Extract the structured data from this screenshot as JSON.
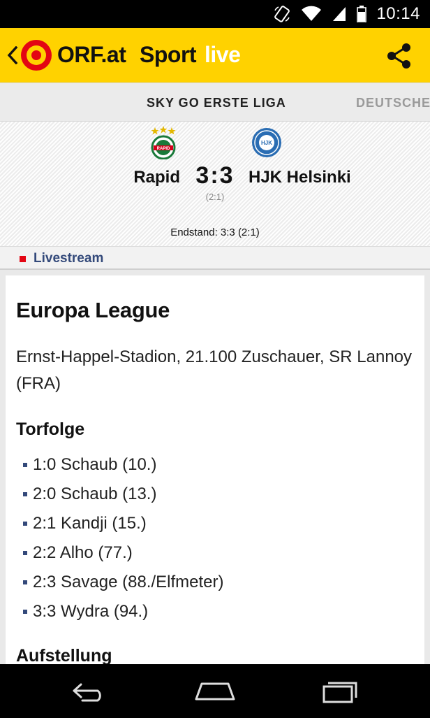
{
  "status_bar": {
    "time": "10:14",
    "icons": [
      "rotate-icon",
      "wifi-icon",
      "signal-icon",
      "battery-icon"
    ]
  },
  "header": {
    "brand": "ORF.at",
    "section": "Sport",
    "section_suffix": "live",
    "colors": {
      "background": "#ffd200",
      "suffix": "#ffffff",
      "logo_red": "#e30613"
    }
  },
  "tabs": [
    {
      "label": "SKY GO ERSTE LIGA",
      "active": true
    },
    {
      "label": "DEUTSCHE",
      "active": false
    }
  ],
  "match": {
    "home_team": "Rapid",
    "away_team": "HJK Helsinki",
    "score": "3:3",
    "halftime": "(2:1)",
    "status": "Endstand: 3:3 (2:1)"
  },
  "livestream": {
    "label": "Livestream",
    "dot_color": "#e30613"
  },
  "article": {
    "title": "Europa League",
    "venue": "Ernst-Happel-Stadion, 21.100 Zuschauer, SR Lannoy (FRA)",
    "goals_heading": "Torfolge",
    "goals": [
      "1:0 Schaub (10.)",
      "2:0 Schaub (13.)",
      "2:1 Kandji (15.)",
      "2:2 Alho (77.)",
      "2:3 Savage (88./Elfmeter)",
      "3:3 Wydra (94.)"
    ],
    "lineup_heading": "Aufstellung"
  },
  "nav": {
    "buttons": [
      "back-icon",
      "home-icon",
      "recents-icon"
    ]
  }
}
